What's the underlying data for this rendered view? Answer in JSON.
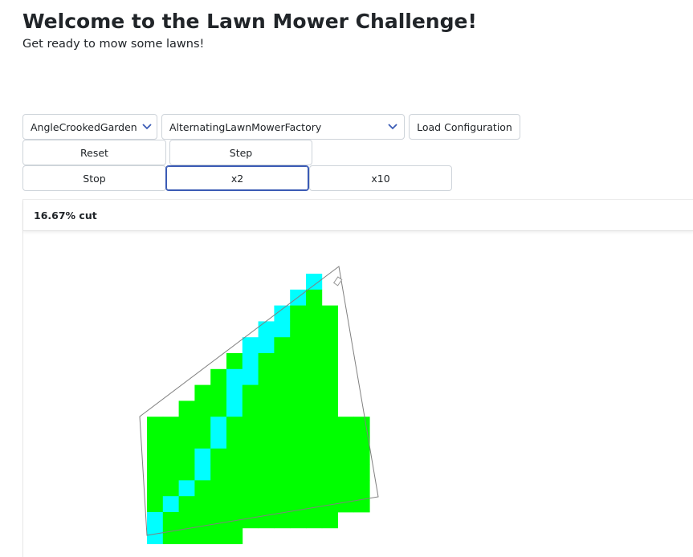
{
  "header": {
    "title": "Welcome to the Lawn Mower Challenge!",
    "subtitle": "Get ready to mow some lawns!"
  },
  "controls": {
    "garden_select": {
      "value": "AngleCrookedGarden"
    },
    "factory_select": {
      "value": "AlternatingLawnMowerFactory"
    },
    "load_label": "Load Configuration",
    "reset_label": "Reset",
    "step_label": "Step",
    "stop_label": "Stop",
    "x2_label": "x2",
    "x10_label": "x10",
    "active_speed": "x2"
  },
  "status": {
    "cut_text": "16.67% cut",
    "cut_percent": 16.67
  },
  "lawn": {
    "cols": 14,
    "rows": 17,
    "colors": {
      "grass": "#00ff00",
      "cut": "#00ffff",
      "outline": "#808080"
    },
    "grid": [
      "..........C...",
      ".........CG...",
      "........CGGG..",
      ".......CCGGG..",
      "......CCGGGG..",
      ".....GCGGGGG..",
      "....GCCGGGGG..",
      "...GGCGGGGGG..",
      "..GGGCGGGGGG..",
      "GGGGCGGGGGGGGG",
      "GGGGCGGGGGGGGG",
      "GGGCGGGGGGGGGG",
      "GGGCGGGGGGGGGG",
      "GGCGGGGGGGGGGG",
      "GCGGGGGGGGGGGG",
      "CGGGGGGGGGGG..",
      "CGGGGG........"
    ]
  }
}
